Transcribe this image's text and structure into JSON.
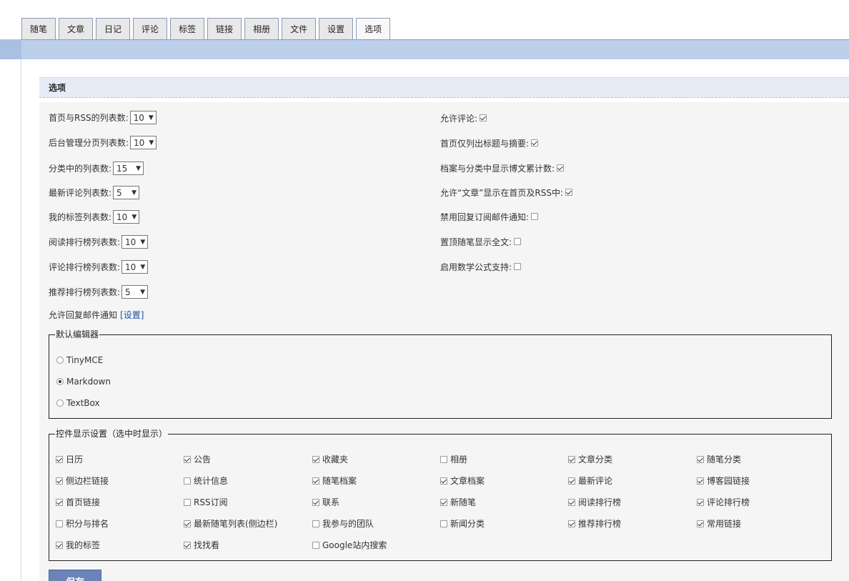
{
  "tabs": [
    {
      "label": "随笔",
      "active": false
    },
    {
      "label": "文章",
      "active": false
    },
    {
      "label": "日记",
      "active": false
    },
    {
      "label": "评论",
      "active": false
    },
    {
      "label": "标签",
      "active": false
    },
    {
      "label": "链接",
      "active": false
    },
    {
      "label": "相册",
      "active": false
    },
    {
      "label": "文件",
      "active": false
    },
    {
      "label": "设置",
      "active": false
    },
    {
      "label": "选项",
      "active": true
    }
  ],
  "section_title": "选项",
  "left_options": [
    {
      "label": "首页与RSS的列表数:",
      "value": "10"
    },
    {
      "label": "后台管理分页列表数:",
      "value": "10"
    },
    {
      "label": "分类中的列表数:",
      "value": "15"
    },
    {
      "label": "最新评论列表数:",
      "value": "5"
    },
    {
      "label": "我的标签列表数:",
      "value": "10"
    },
    {
      "label": "阅读排行榜列表数:",
      "value": "10"
    },
    {
      "label": "评论排行榜列表数:",
      "value": "10"
    },
    {
      "label": "推荐排行榜列表数:",
      "value": "5"
    }
  ],
  "reply_notify": {
    "label": "允许回复邮件通知",
    "link": "[设置]"
  },
  "right_options": [
    {
      "label": "允许评论:",
      "checked": true
    },
    {
      "label": "首页仅列出标题与摘要:",
      "checked": true
    },
    {
      "label": "档案与分类中显示博文累计数:",
      "checked": true
    },
    {
      "label": "允许“文章”显示在首页及RSS中:",
      "checked": true
    },
    {
      "label": "禁用回复订阅邮件通知:",
      "checked": false
    },
    {
      "label": "置顶随笔显示全文:",
      "checked": false
    },
    {
      "label": "启用数学公式支持:",
      "checked": false
    }
  ],
  "editor": {
    "legend": "默认编辑器",
    "options": [
      {
        "label": "TinyMCE",
        "selected": false
      },
      {
        "label": "Markdown",
        "selected": true
      },
      {
        "label": "TextBox",
        "selected": false
      }
    ]
  },
  "controls": {
    "legend": "控件显示设置（选中时显示）",
    "items": [
      {
        "label": "日历",
        "checked": true
      },
      {
        "label": "公告",
        "checked": true
      },
      {
        "label": "收藏夹",
        "checked": true
      },
      {
        "label": "相册",
        "checked": false
      },
      {
        "label": "文章分类",
        "checked": true
      },
      {
        "label": "随笔分类",
        "checked": true
      },
      {
        "label": "侧边栏链接",
        "checked": true
      },
      {
        "label": "统计信息",
        "checked": false
      },
      {
        "label": "随笔档案",
        "checked": true
      },
      {
        "label": "文章档案",
        "checked": true
      },
      {
        "label": "最新评论",
        "checked": true
      },
      {
        "label": "博客园链接",
        "checked": true
      },
      {
        "label": "首页链接",
        "checked": true
      },
      {
        "label": "RSS订阅",
        "checked": false
      },
      {
        "label": "联系",
        "checked": true
      },
      {
        "label": "新随笔",
        "checked": true
      },
      {
        "label": "阅读排行榜",
        "checked": true
      },
      {
        "label": "评论排行榜",
        "checked": true
      },
      {
        "label": "积分与排名",
        "checked": false
      },
      {
        "label": "最新随笔列表(侧边栏)",
        "checked": true
      },
      {
        "label": "我参与的团队",
        "checked": false
      },
      {
        "label": "新闻分类",
        "checked": false
      },
      {
        "label": "推荐排行榜",
        "checked": true
      },
      {
        "label": "常用链接",
        "checked": true
      },
      {
        "label": "我的标签",
        "checked": true
      },
      {
        "label": "找找看",
        "checked": true
      },
      {
        "label": "Google站内搜索",
        "checked": false
      }
    ]
  },
  "save_label": "保存",
  "colors": {
    "tab_bar": "#bcd0ec",
    "section_head": "#e6ecf6",
    "button": "#6b84b8"
  }
}
